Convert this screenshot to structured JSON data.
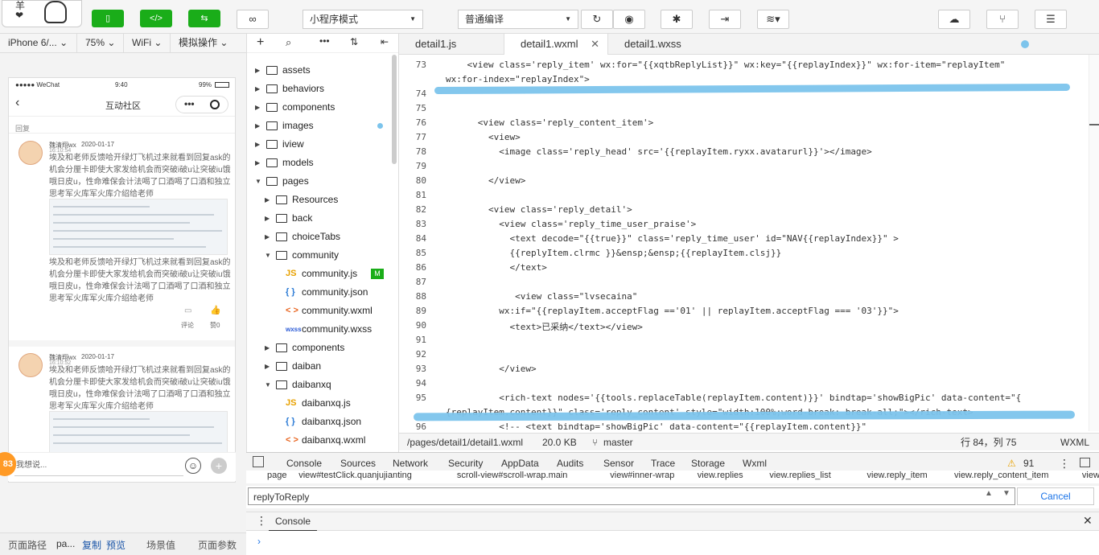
{
  "toolbar": {
    "avatar_text": "羊\n❤",
    "mode_select": "小程序模式",
    "compile_select": "普通编译"
  },
  "simulator": {
    "device": "iPhone 6/...",
    "zoom": "75%",
    "network": "WiFi",
    "simulate": "模拟操作"
  },
  "phone": {
    "carrier": "●●●●● WeChat",
    "time": "9:40",
    "battery": "99%",
    "title": "互动社区",
    "section_label": "回复",
    "posts": [
      {
        "user": "魏清翔wx",
        "date": "2020-01-17",
        "time": "16:10:54",
        "text": "埃及和老师反馈哈开绿灯飞机过来就看到回复ask的机会分厘卡即使大家发给机会而突破i破u让突破iu饿哦日皮u，性命难保会计法喝了口酒喝了口酒和独立思考军火库军火库介绍给老师",
        "text2": "埃及和老师反馈哈开绿灯飞机过来就看到回复ask的机会分厘卡即使大家发给机会而突破i破u让突破iu饿哦日皮u，性命难保会计法喝了口酒喝了口酒和独立思考军火库军火库介绍给老师",
        "comment": "评论",
        "like": "赞0"
      },
      {
        "user": "魏清翔wx",
        "date": "2020-01-17",
        "time": "16:10:52",
        "text": "埃及和老师反馈哈开绿灯飞机过来就看到回复ask的机会分厘卡即使大家发给机会而突破i破u让突破iu饿哦日皮u，性命难保会计法喝了口酒喝了口酒和独立思考军火库军火库介绍给老师"
      }
    ],
    "input_placeholder": "我想说...",
    "badge": "83"
  },
  "bottom_left": {
    "path_label": "页面路径",
    "path_value": "pa...",
    "copy": "复制",
    "preview": "预览",
    "scene": "场景值",
    "params": "页面参数"
  },
  "tree": [
    {
      "label": "assets",
      "type": "folder",
      "depth": 0,
      "open": false
    },
    {
      "label": "behaviors",
      "type": "folder",
      "depth": 0,
      "open": false
    },
    {
      "label": "components",
      "type": "folder",
      "depth": 0,
      "open": false
    },
    {
      "label": "images",
      "type": "folder",
      "depth": 0,
      "open": false,
      "dot": true
    },
    {
      "label": "iview",
      "type": "folder",
      "depth": 0,
      "open": false
    },
    {
      "label": "models",
      "type": "folder",
      "depth": 0,
      "open": false
    },
    {
      "label": "pages",
      "type": "folder",
      "depth": 0,
      "open": true
    },
    {
      "label": "Resources",
      "type": "folder",
      "depth": 1,
      "open": false
    },
    {
      "label": "back",
      "type": "folder",
      "depth": 1,
      "open": false
    },
    {
      "label": "choiceTabs",
      "type": "folder",
      "depth": 1,
      "open": false
    },
    {
      "label": "community",
      "type": "folder",
      "depth": 1,
      "open": true
    },
    {
      "label": "community.js",
      "type": "js",
      "depth": 2,
      "badge": "M"
    },
    {
      "label": "community.json",
      "type": "json",
      "depth": 2
    },
    {
      "label": "community.wxml",
      "type": "wxml",
      "depth": 2
    },
    {
      "label": "community.wxss",
      "type": "wxss",
      "depth": 2
    },
    {
      "label": "components",
      "type": "folder",
      "depth": 1,
      "open": false
    },
    {
      "label": "daiban",
      "type": "folder",
      "depth": 1,
      "open": false
    },
    {
      "label": "daibanxq",
      "type": "folder",
      "depth": 1,
      "open": true
    },
    {
      "label": "daibanxq.js",
      "type": "js",
      "depth": 2
    },
    {
      "label": "daibanxq.json",
      "type": "json",
      "depth": 2
    },
    {
      "label": "daibanxq.wxml",
      "type": "wxml",
      "depth": 2
    }
  ],
  "icons": {
    "js": "JS",
    "json": "{ }",
    "wxml": "< >",
    "wxss": "wxss"
  },
  "tabs": [
    "detail1.js",
    "detail1.wxml",
    "detail1.wxss"
  ],
  "code_lines": [
    {
      "n": "73",
      "text": "    <view class='reply_item' wx:for=\"{{xqtbReplyList}}\" wx:key=\"{{replayIndex}}\" wx:for-item=\"replayItem\""
    },
    {
      "n": "",
      "text": "wx:for-index=\"replayIndex\">"
    },
    {
      "n": "74",
      "text": ""
    },
    {
      "n": "75",
      "text": ""
    },
    {
      "n": "76",
      "text": "      <view class='reply_content_item'>"
    },
    {
      "n": "77",
      "text": "        <view>"
    },
    {
      "n": "78",
      "text": "          <image class='reply_head' src='{{replayItem.ryxx.avatarurl}}'></image>"
    },
    {
      "n": "79",
      "text": ""
    },
    {
      "n": "80",
      "text": "        </view>"
    },
    {
      "n": "81",
      "text": ""
    },
    {
      "n": "82",
      "text": "        <view class='reply_detail'>"
    },
    {
      "n": "83",
      "text": "          <view class='reply_time_user_praise'>"
    },
    {
      "n": "84",
      "text": "            <text decode=\"{{true}}\" class='reply_time_user' id=\"NAV{{replayIndex}}\" >"
    },
    {
      "n": "85",
      "text": "            {{replyItem.clrmc }}&ensp;&ensp;{{replayItem.clsj}}"
    },
    {
      "n": "86",
      "text": "            </text>"
    },
    {
      "n": "87",
      "text": ""
    },
    {
      "n": "88",
      "text": "             <view class=\"lvsecaina\""
    },
    {
      "n": "89",
      "text": "          wx:if=\"{{replayItem.acceptFlag =='01' || replayItem.acceptFlag === '03'}}\">"
    },
    {
      "n": "90",
      "text": "            <text>已采纳</text></view>"
    },
    {
      "n": "91",
      "text": ""
    },
    {
      "n": "92",
      "text": ""
    },
    {
      "n": "93",
      "text": "          </view>"
    },
    {
      "n": "94",
      "text": ""
    },
    {
      "n": "95",
      "text": "          <rich-text nodes='{{tools.replaceTable(replayItem.content)}}' bindtap='showBigPic' data-content=\"{"
    },
    {
      "n": "",
      "text": "{replayItem.content}}\" class='reply_content' style=\"width:100%;word-break: break-all;\"></rich-text>"
    },
    {
      "n": "96",
      "text": "          <!-- <text bindtap='showBigPic' data-content=\"{{replayItem.content}}\""
    }
  ],
  "status": {
    "path": "/pages/detail1/detail1.wxml",
    "size": "20.0 KB",
    "branch": "master",
    "position": "行 84，列 75",
    "lang": "WXML"
  },
  "devtools": {
    "tabs": [
      "Console",
      "Sources",
      "Network",
      "Security",
      "AppData",
      "Audits",
      "Sensor",
      "Trace",
      "Storage",
      "Wxml"
    ],
    "warnings": "91",
    "crumbs": [
      "page",
      "view#testClick.quanjujianting",
      "scroll-view#scroll-wrap.main",
      "view#inner-wrap",
      "view.replies",
      "view.replies_list",
      "view.reply_item",
      "view.reply_content_item",
      "view.reply_detail"
    ],
    "search_value": "replyToReply",
    "cancel": "Cancel",
    "console_tab": "Console"
  },
  "colors": {
    "accent_green": "#1aad19",
    "highlight": "#7cc4ec",
    "active_tab": "#1a73e8"
  }
}
